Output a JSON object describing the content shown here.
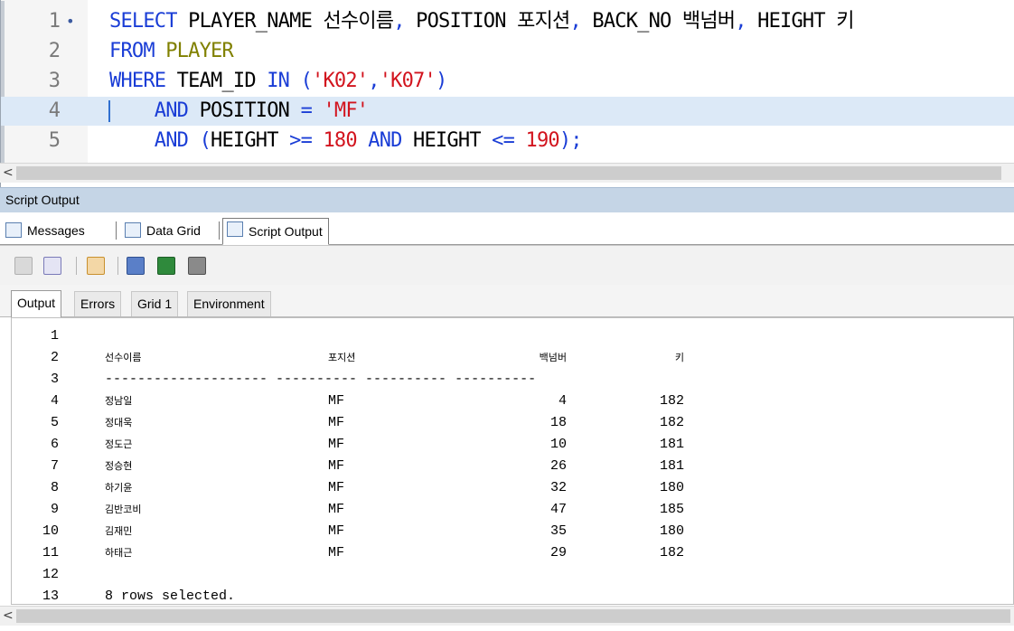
{
  "editor": {
    "lines": [
      {
        "num": "1",
        "mark": "•",
        "parts": [
          {
            "t": "SELECT ",
            "c": "kw"
          },
          {
            "t": "PLAYER_NAME ",
            "c": "id"
          },
          {
            "t": "선수이름",
            "c": "id"
          },
          {
            "t": ", ",
            "c": "kw"
          },
          {
            "t": "POSITION ",
            "c": "id"
          },
          {
            "t": "포지션",
            "c": "id"
          },
          {
            "t": ", ",
            "c": "kw"
          },
          {
            "t": "BACK_NO ",
            "c": "id"
          },
          {
            "t": "백넘버",
            "c": "id"
          },
          {
            "t": ", ",
            "c": "kw"
          },
          {
            "t": "HEIGHT ",
            "c": "id"
          },
          {
            "t": "키",
            "c": "id"
          }
        ]
      },
      {
        "num": "2",
        "mark": "",
        "parts": [
          {
            "t": "FROM ",
            "c": "kw"
          },
          {
            "t": "PLAYER",
            "c": "tbl"
          }
        ]
      },
      {
        "num": "3",
        "mark": "",
        "parts": [
          {
            "t": "WHERE ",
            "c": "kw"
          },
          {
            "t": "TEAM_ID ",
            "c": "id"
          },
          {
            "t": "IN ",
            "c": "kw"
          },
          {
            "t": "(",
            "c": "kw"
          },
          {
            "t": "'K02'",
            "c": "str"
          },
          {
            "t": ",",
            "c": "kw"
          },
          {
            "t": "'K07'",
            "c": "str"
          },
          {
            "t": ")",
            "c": "kw"
          }
        ]
      },
      {
        "num": "4",
        "mark": "",
        "current": true,
        "parts": [
          {
            "t": "    AND ",
            "c": "kw"
          },
          {
            "t": "POSITION ",
            "c": "id"
          },
          {
            "t": "= ",
            "c": "op"
          },
          {
            "t": "'MF'",
            "c": "str"
          }
        ]
      },
      {
        "num": "5",
        "mark": "",
        "parts": [
          {
            "t": "    AND ",
            "c": "kw"
          },
          {
            "t": "(",
            "c": "kw"
          },
          {
            "t": "HEIGHT ",
            "c": "id"
          },
          {
            "t": ">= ",
            "c": "op"
          },
          {
            "t": "180 ",
            "c": "num"
          },
          {
            "t": "AND ",
            "c": "kw"
          },
          {
            "t": "HEIGHT ",
            "c": "id"
          },
          {
            "t": "<= ",
            "c": "op"
          },
          {
            "t": "190",
            "c": "num"
          },
          {
            "t": ");",
            "c": "kw"
          }
        ]
      }
    ]
  },
  "scroll_left_glyph": "<",
  "panel": {
    "title": "Script Output",
    "tabs": [
      "Messages",
      "Data Grid",
      "Script Output"
    ],
    "active_tab": "Script Output",
    "subtabs": [
      "Output",
      "Errors",
      "Grid 1",
      "Environment"
    ],
    "active_subtab": "Output"
  },
  "toolbar_icons": [
    "copy-icon",
    "find-icon",
    "clear-icon",
    "save-icon",
    "excel-icon",
    "print-icon"
  ],
  "output": {
    "line_numbers": [
      "1",
      "2",
      "3",
      "4",
      "5",
      "6",
      "7",
      "8",
      "9",
      "10",
      "11",
      "12",
      "13"
    ],
    "headers": [
      "선수이름",
      "포지션",
      "백넘버",
      "키"
    ],
    "separator": "-------------------- ---------- ---------- ----------",
    "rows": [
      [
        "정남일",
        "MF",
        "4",
        "182"
      ],
      [
        "정대욱",
        "MF",
        "18",
        "182"
      ],
      [
        "정도근",
        "MF",
        "10",
        "181"
      ],
      [
        "정승현",
        "MF",
        "26",
        "181"
      ],
      [
        "하기윤",
        "MF",
        "32",
        "180"
      ],
      [
        "김반코비",
        "MF",
        "47",
        "185"
      ],
      [
        "김재민",
        "MF",
        "35",
        "180"
      ],
      [
        "하태근",
        "MF",
        "29",
        "182"
      ]
    ],
    "footer": "8 rows selected."
  }
}
